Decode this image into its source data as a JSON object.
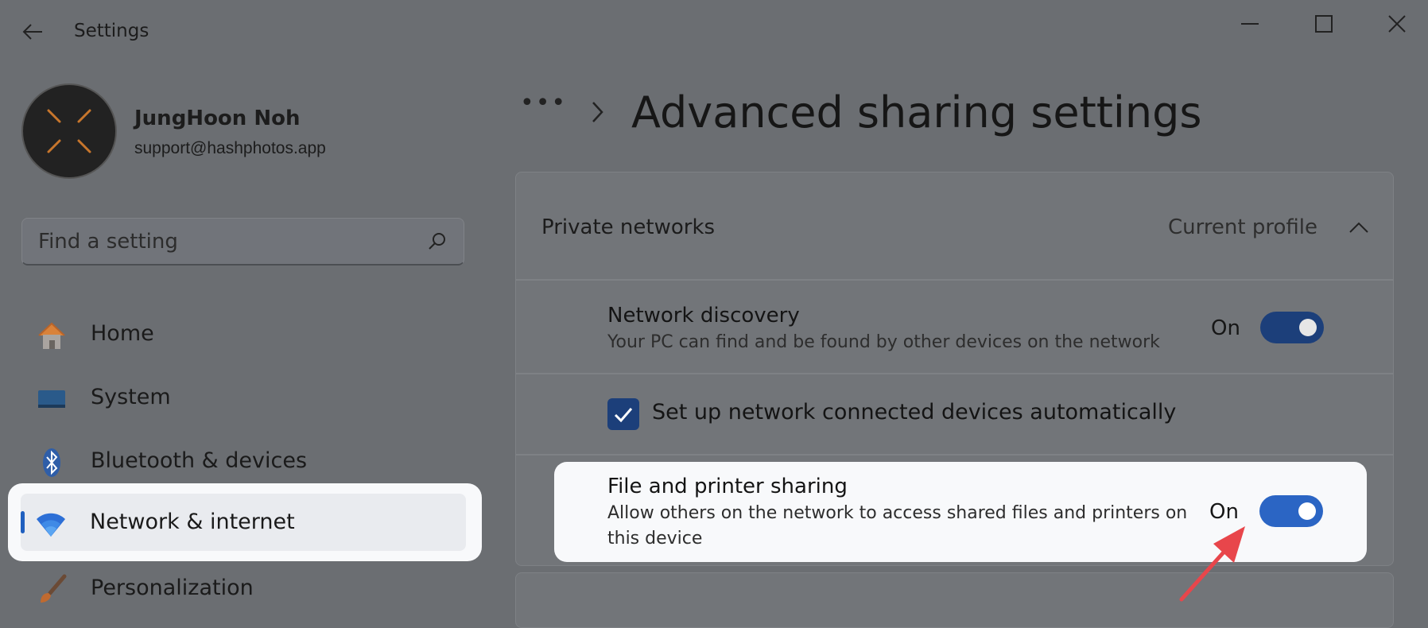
{
  "app": {
    "title": "Settings"
  },
  "profile": {
    "name": "JungHoon Noh",
    "email": "support@hashphotos.app"
  },
  "search": {
    "placeholder": "Find a setting"
  },
  "nav": {
    "items": [
      {
        "label": "Home",
        "icon": "home-icon"
      },
      {
        "label": "System",
        "icon": "system-icon"
      },
      {
        "label": "Bluetooth & devices",
        "icon": "bluetooth-icon"
      },
      {
        "label": "Network & internet",
        "icon": "wifi-icon",
        "selected": true
      },
      {
        "label": "Personalization",
        "icon": "brush-icon"
      }
    ]
  },
  "breadcrumb": {
    "overflow": "•••"
  },
  "page": {
    "title": "Advanced sharing settings"
  },
  "private_networks": {
    "title": "Private networks",
    "status": "Current profile",
    "network_discovery": {
      "title": "Network discovery",
      "description": "Your PC can find and be found by other devices on the network",
      "state": "On"
    },
    "auto_setup": {
      "label": "Set up network connected devices automatically",
      "checked": true
    },
    "file_printer_sharing": {
      "title": "File and printer sharing",
      "description_line1": "Allow others on the network to access shared files and printers on",
      "description_line2": "this device",
      "state": "On"
    }
  },
  "colors": {
    "accent": "#2b65c4",
    "annotation_arrow": "#e8464b"
  }
}
